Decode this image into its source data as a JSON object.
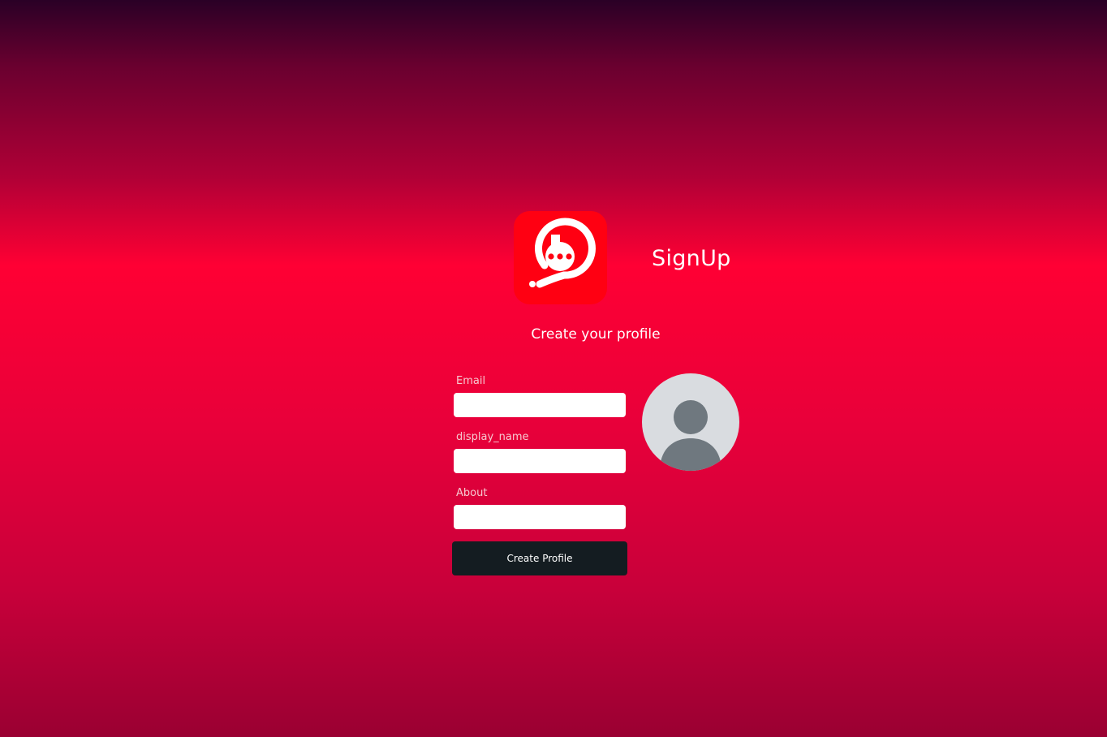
{
  "header": {
    "logo_icon": "chat-bubble-logo-icon",
    "title": "SignUp",
    "subtitle": "Create your profile"
  },
  "form": {
    "email_label": "Email",
    "email_value": "",
    "display_name_label": "display_name",
    "display_name_value": "",
    "about_label": "About",
    "about_value": "",
    "submit_label": "Create Profile"
  },
  "avatar": {
    "icon": "default-user-avatar-icon"
  },
  "colors": {
    "accent": "#ff0012",
    "button_bg": "#141c21",
    "background_mid": "#ff0034",
    "avatar_bg": "#d9dce0",
    "avatar_figure": "#6f787f"
  }
}
